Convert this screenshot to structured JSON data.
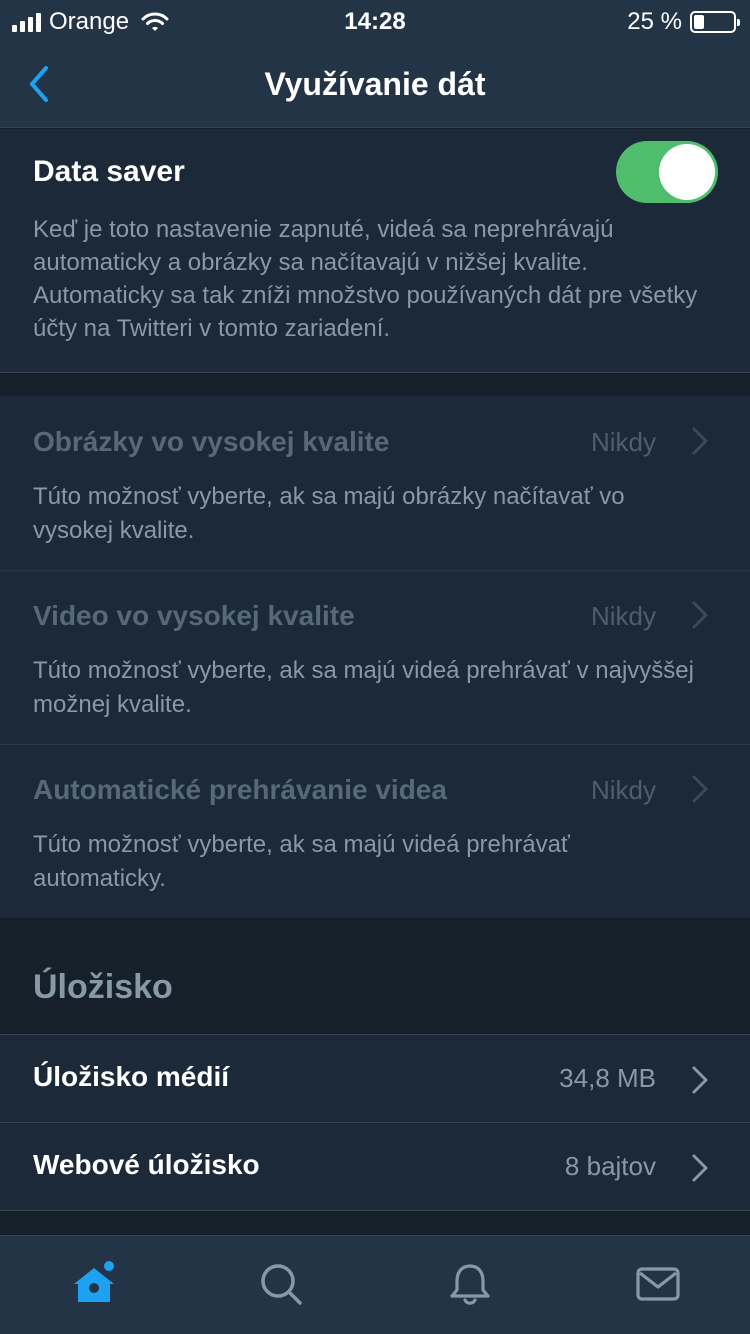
{
  "status_bar": {
    "carrier": "Orange",
    "time": "14:28",
    "battery_percent": "25 %",
    "battery_level": 0.25
  },
  "nav": {
    "title": "Využívanie dát",
    "back_icon": "chevron-left-icon"
  },
  "data_saver": {
    "title": "Data saver",
    "enabled": true,
    "description": "Keď je toto nastavenie zapnuté, videá sa neprehrávajú automaticky a obrázky sa načítavajú v nižšej kvalite. Automaticky sa tak zníži množstvo používaných dát pre všetky účty na Twitteri v tomto zariadení."
  },
  "quality_settings": [
    {
      "title": "Obrázky vo vysokej kvalite",
      "value": "Nikdy",
      "description": "Túto možnosť vyberte, ak sa majú obrázky načítavať vo vysokej kvalite."
    },
    {
      "title": "Video vo vysokej kvalite",
      "value": "Nikdy",
      "description": "Túto možnosť vyberte, ak sa majú videá prehrávať v najvyššej možnej kvalite."
    },
    {
      "title": "Automatické prehrávanie videa",
      "value": "Nikdy",
      "description": "Túto možnosť vyberte, ak sa majú videá prehrávať automaticky."
    }
  ],
  "storage": {
    "header": "Úložisko",
    "items": [
      {
        "title": "Úložisko médií",
        "value": "34,8 MB"
      },
      {
        "title": "Webové úložisko",
        "value": "8 bajtov"
      }
    ]
  },
  "tab_bar": {
    "tabs": [
      "home-icon",
      "search-icon",
      "notifications-icon",
      "messages-icon"
    ],
    "active_tab": "home-icon"
  },
  "colors": {
    "accent": "#1da1f2",
    "toggle_on": "#4fbd6c",
    "background": "#15202b",
    "section": "#1c2938",
    "bar": "#243447"
  }
}
